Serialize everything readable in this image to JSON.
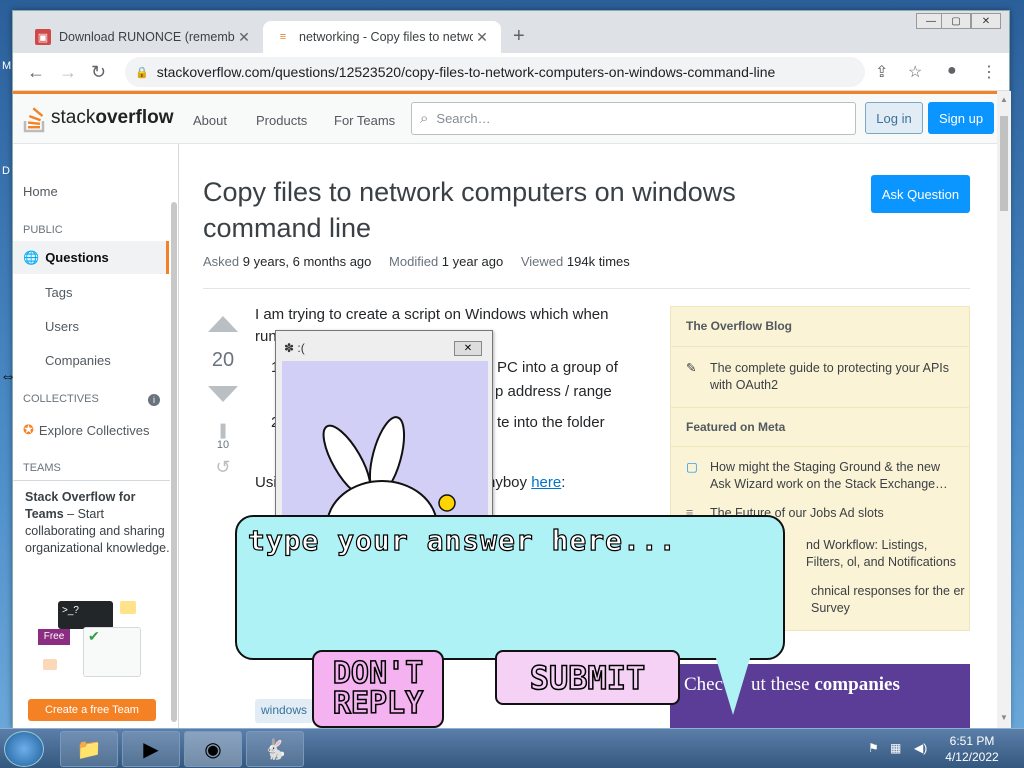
{
  "browser": {
    "tabs": [
      {
        "title": "Download RUNONCE (remembe",
        "icon": "download-site-icon"
      },
      {
        "title": "networking - Copy files to netwo",
        "icon": "stackoverflow-icon"
      }
    ],
    "url": "stackoverflow.com/questions/12523520/copy-files-to-network-computers-on-windows-command-line"
  },
  "so": {
    "logo_plain": "stack",
    "logo_bold": "overflow",
    "nav": [
      "About",
      "Products",
      "For Teams"
    ],
    "search_placeholder": "Search…",
    "login": "Log in",
    "signup": "Sign up"
  },
  "leftnav": {
    "home": "Home",
    "public": "PUBLIC",
    "questions": "Questions",
    "tags": "Tags",
    "users": "Users",
    "companies": "Companies",
    "collectives": "COLLECTIVES",
    "explore": "Explore Collectives",
    "teams": "TEAMS",
    "teams_title": "Stack Overflow for Teams",
    "teams_dash": " – Start collaborating and sharing organizational knowledge.",
    "free": "Free",
    "create_team": "Create a free Team"
  },
  "question": {
    "title": "Copy files to network computers on windows command line",
    "ask_button": "Ask Question",
    "asked_label": "Asked",
    "asked": "9 years, 6 months ago",
    "modified_label": "Modified",
    "modified": "1 year ago",
    "viewed_label": "Viewed",
    "viewed": "194k times",
    "score": "20",
    "bookmarks": "10",
    "body_line1": "I am trying to create a script on Windows which when",
    "body_line2": "run on an admin PC:",
    "item1_a": "1",
    "item1_b": "PC into a group of",
    "item1_c": "p address / range",
    "item2_a": "2",
    "item2_b": "te into the folder",
    "using_a": "Usi",
    "using_b": "nyboy",
    "using_link": "here",
    "using_c": ":",
    "tag": "windows"
  },
  "sidebar": {
    "blog_heading": "The Overflow Blog",
    "blog_items": [
      "The complete guide to protecting your APIs with OAuth2"
    ],
    "meta_heading": "Featured on Meta",
    "meta_items": [
      "How might the Staging Ground & the new Ask Wizard work on the Stack Exchange…",
      "The Future of our Jobs Ad slots",
      "nd Workflow: Listings, Filters, ol, and Notifications",
      "chnical responses for the er Survey"
    ],
    "promo_a": "Chec",
    "promo_b": "ut these",
    "promo_bold": "companies"
  },
  "popup": {
    "title": ":("
  },
  "prank": {
    "input_placeholder": "type your answer here...",
    "dont_reply": "DON'T REPLY",
    "submit": "SUBMIT"
  },
  "taskbar": {
    "time": "6:51 PM",
    "date": "4/12/2022"
  },
  "colors": {
    "so_orange": "#f48225",
    "so_blue": "#0a95ff",
    "bubble": "#aff2f6",
    "button_pink": "#f4b2f0"
  }
}
